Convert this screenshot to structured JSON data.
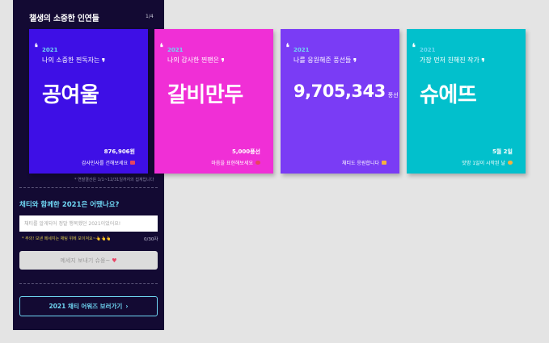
{
  "panel": {
    "title": "챌생의 소중한 인연들",
    "page_indicator": "1/4",
    "cards": [
      {
        "year": "2021",
        "subtitle": "나의 소중한 찐독자는",
        "main": "공여울",
        "unit": "",
        "stat": "876,906원",
        "footer": "감사인사를 건해보세요",
        "color": "#3e0fe6",
        "emoji_color": "#e8455e"
      },
      {
        "year": "2021",
        "subtitle": "나의 감사한 찐팬은",
        "main": "갈비만두",
        "unit": "",
        "stat": "5,000풍선",
        "footer": "마음을 표현해보세요",
        "color": "#f02fd6",
        "emoji_color": "#e8455e"
      },
      {
        "year": "2021",
        "subtitle": "나를 응원해준 풍선들",
        "main": "9,705,343",
        "unit": "풍선",
        "stat": "",
        "footer": "채티도 응원합니다",
        "color": "#7a3cf5",
        "emoji_color": "#f6b13e"
      },
      {
        "year": "2021",
        "subtitle": "가장 먼저 친해진 작가",
        "main": "슈에뜨",
        "unit": "",
        "stat": "5월 2일",
        "footer": "맛밤 1일이 시작된 날",
        "color": "#02c0cc",
        "emoji_color": "#f6b13e"
      }
    ],
    "note": "* 연말결산은 1/1~12/31일까지의 집계입니다",
    "question": "채티와 함께한 2021은 어땠나요?",
    "input_placeholder": "채티를 알게되어 정말 행복했던 2021이었어요!",
    "hint": "* 주의! 보낸 메세지는 채팅 위에 보이져요~👆👆👆",
    "counter": "0/30자",
    "send_button": "메세지 보내기 슈웅~",
    "awards_button": "2021 채티 어워즈 보러가기"
  },
  "colors": {
    "panel_bg": "#130a33",
    "accent": "#6fd6f3",
    "year_text": "#6fd6f3"
  }
}
